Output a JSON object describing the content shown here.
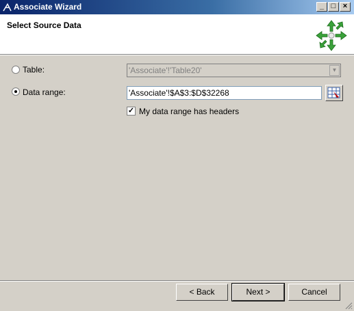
{
  "window": {
    "title": "Associate Wizard"
  },
  "header": {
    "title": "Select Source Data"
  },
  "source": {
    "table_label": "Table:",
    "table_value": "'Associate'!'Table20'",
    "range_label": "Data range:",
    "range_value": "'Associate'!$A$3:$D$32268",
    "headers_label": "My data range has headers",
    "headers_checked": true,
    "selected": "range"
  },
  "buttons": {
    "back": "< Back",
    "next": "Next >",
    "cancel": "Cancel"
  },
  "icons": {
    "app": "wizard-icon",
    "logo": "arrows-logo-icon",
    "range_picker": "range-select-icon"
  },
  "colors": {
    "titlebar": "#0a246a",
    "logo_green": "#3aa23a"
  }
}
